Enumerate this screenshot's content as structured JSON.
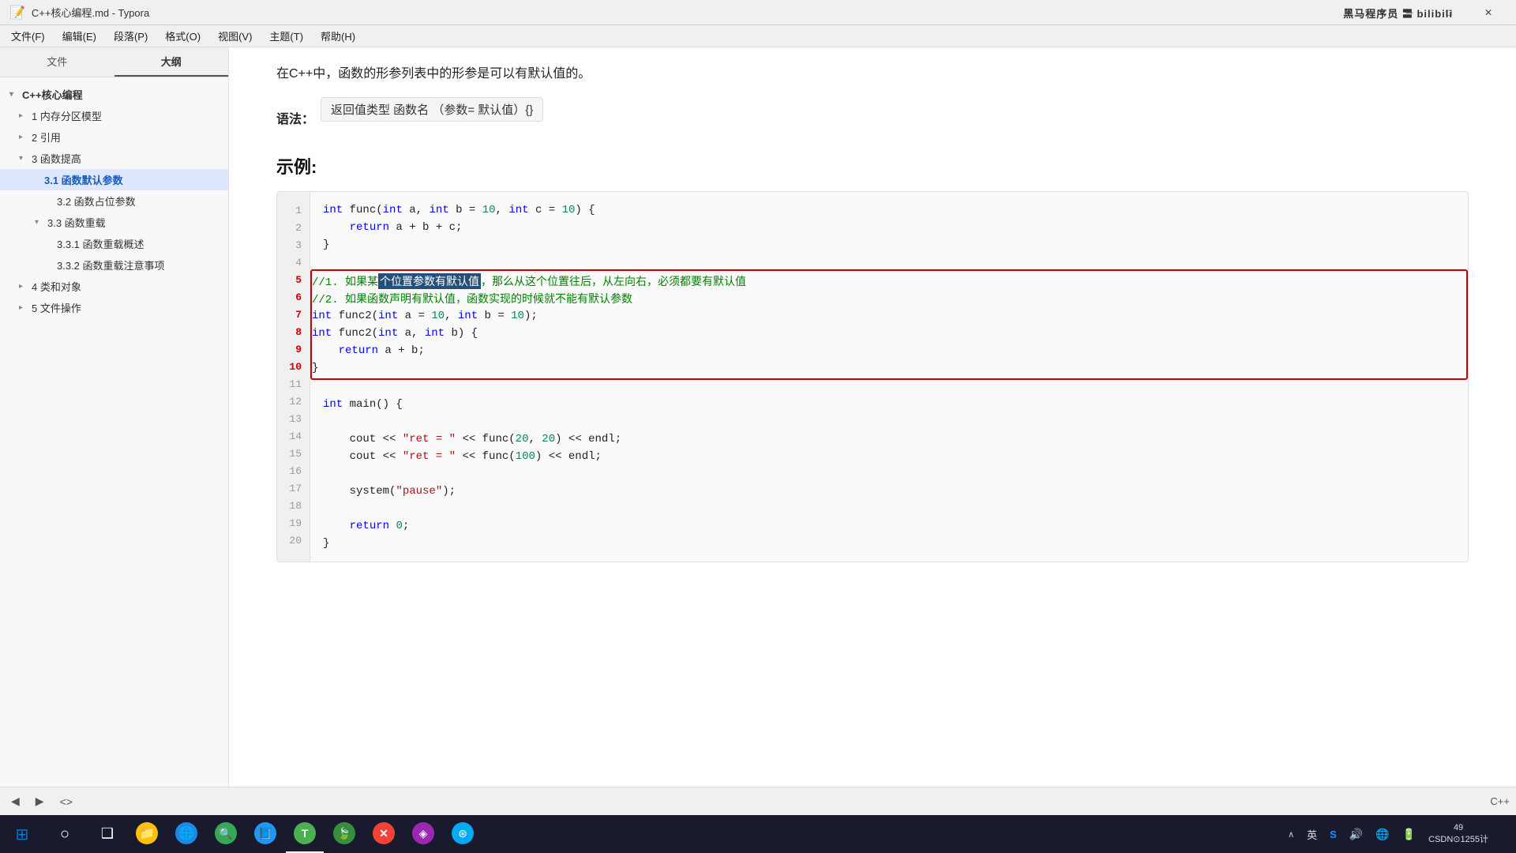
{
  "window": {
    "title": "C++核心编程.md - Typora"
  },
  "titlebar": {
    "title": "C++核心编程.md - Typora",
    "minimize_label": "─",
    "maximize_label": "□",
    "close_label": "✕"
  },
  "menubar": {
    "items": [
      "文件(F)",
      "编辑(E)",
      "段落(P)",
      "格式(O)",
      "视图(V)",
      "主题(T)",
      "帮助(H)"
    ]
  },
  "sidebar": {
    "tab_file": "文件",
    "tab_outline": "大纲",
    "outline": [
      {
        "label": "C++核心编程",
        "level": "level1",
        "expanded": true,
        "arrow": "▾"
      },
      {
        "label": "1 内存分区模型",
        "level": "level2",
        "arrow": "▸"
      },
      {
        "label": "2 引用",
        "level": "level2",
        "arrow": "▸"
      },
      {
        "label": "3 函数提高",
        "level": "level2",
        "expanded": true,
        "arrow": "▾"
      },
      {
        "label": "3.1 函数默认参数",
        "level": "level3",
        "arrow": ""
      },
      {
        "label": "3.2 函数占位参数",
        "level": "level3b",
        "arrow": ""
      },
      {
        "label": "3.3 函数重载",
        "level": "level3b-sub",
        "expanded": true,
        "arrow": "▾"
      },
      {
        "label": "3.3.1 函数重载概述",
        "level": "level4",
        "arrow": ""
      },
      {
        "label": "3.3.2 函数重载注意事项",
        "level": "level4",
        "arrow": ""
      },
      {
        "label": "4 类和对象",
        "level": "level2",
        "arrow": "▸"
      },
      {
        "label": "5 文件操作",
        "level": "level2",
        "arrow": "▸"
      }
    ]
  },
  "content": {
    "intro": "在C++中，函数的形参列表中的形参是可以有默认值的。",
    "syntax_label": "语法：",
    "syntax_box": "返回值类型  函数名  （参数= 默认值）{}",
    "example_heading": "示例:",
    "code_lines": [
      {
        "num": 1,
        "text": "int func(int a, int b = 10, int c = 10) {"
      },
      {
        "num": 2,
        "text": "    return a + b + c;"
      },
      {
        "num": 3,
        "text": "}"
      },
      {
        "num": 4,
        "text": ""
      },
      {
        "num": 5,
        "text": "//1. 如果某个位置参数有默认值，那么从这个位置往后，从左向右，必须都要有默认值"
      },
      {
        "num": 6,
        "text": "//2. 如果函数声明有默认值，函数实现的时候就不能有默认参数"
      },
      {
        "num": 7,
        "text": "int func2(int a = 10, int b = 10);"
      },
      {
        "num": 8,
        "text": "int func2(int a, int b) {"
      },
      {
        "num": 9,
        "text": "    return a + b;"
      },
      {
        "num": 10,
        "text": "}"
      },
      {
        "num": 11,
        "text": ""
      },
      {
        "num": 12,
        "text": "int main() {"
      },
      {
        "num": 13,
        "text": ""
      },
      {
        "num": 14,
        "text": "    cout << \"ret = \" << func(20, 20) << endl;"
      },
      {
        "num": 15,
        "text": "    cout << \"ret = \" << func(100) << endl;"
      },
      {
        "num": 16,
        "text": ""
      },
      {
        "num": 17,
        "text": "    system(\"pause\");"
      },
      {
        "num": 18,
        "text": ""
      },
      {
        "num": 19,
        "text": "    return 0;"
      },
      {
        "num": 20,
        "text": "}"
      }
    ]
  },
  "bottom_bar": {
    "btn_left": "◀",
    "btn_right": "▶",
    "btn_code": "<>",
    "status_right": "C++"
  },
  "taskbar": {
    "apps": [
      {
        "name": "start",
        "icon": "⊞",
        "color": "#0078d4"
      },
      {
        "name": "search",
        "icon": "○",
        "color": "#fff"
      },
      {
        "name": "task-view",
        "icon": "❑",
        "color": "#fff"
      },
      {
        "name": "file-explorer",
        "icon": "📁",
        "color": "#ffc107"
      },
      {
        "name": "browser",
        "icon": "🌐",
        "color": "#0078d4"
      },
      {
        "name": "app1",
        "icon": "🔍",
        "color": "#34a853"
      },
      {
        "name": "app2",
        "icon": "📘",
        "color": "#2196F3"
      },
      {
        "name": "app3",
        "icon": "T",
        "color": "#4CAF50"
      },
      {
        "name": "app4",
        "icon": "🍃",
        "color": "#4CAF50"
      },
      {
        "name": "app5",
        "icon": "✕",
        "color": "#f44336"
      },
      {
        "name": "app6",
        "icon": "◈",
        "color": "#9c27b0"
      },
      {
        "name": "app7",
        "icon": "⊛",
        "color": "#03a9f4"
      }
    ],
    "system_tray": {
      "ime_label": "英",
      "time": "49",
      "date": "49"
    }
  }
}
